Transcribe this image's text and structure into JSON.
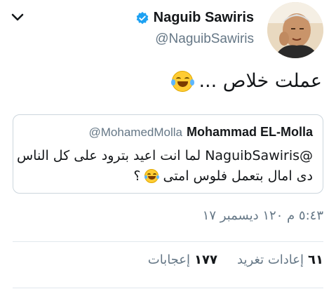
{
  "author": {
    "display_name": "Naguib Sawiris",
    "handle": "@NaguibSawiris",
    "avatar": "profile-photo",
    "verified_icon": "verified-badge-icon"
  },
  "colors": {
    "verified": "#1da1f2",
    "muted": "#657786",
    "text": "#14171a",
    "border": "#ccd6dd"
  },
  "tweet": {
    "text": "عملت خلاص ...",
    "emoji": "face-with-tears-of-joy"
  },
  "quoted_tweet": {
    "display_name": "Mohammad EL-Molla",
    "handle": "@MohamedMolla",
    "line1": "@NaguibSawiris لما انت اعيد بترود على كل الناس",
    "line2": "دى امال بتعمل فلوس امتى",
    "line2_suffix": "؟",
    "emoji": "face-with-tears-of-joy"
  },
  "timestamp": "٥:٤٣ م ١٢٠ ديسمبر ١٧",
  "stats": {
    "retweets_count": "٦١",
    "retweets_label": "إعادات تغريد",
    "likes_count": "١٧٧",
    "likes_label": "إعجابات"
  },
  "menu_icon": "chevron-down-icon"
}
